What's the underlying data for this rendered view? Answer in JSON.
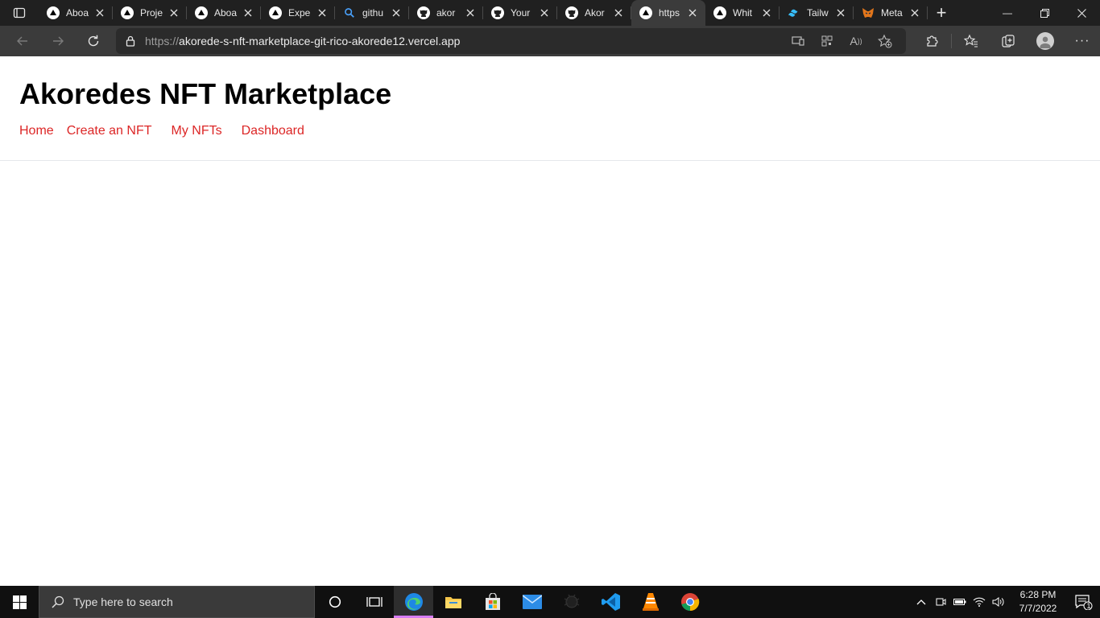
{
  "browser": {
    "tabs": [
      {
        "title": "Aboa",
        "favicon": "vercel-icon"
      },
      {
        "title": "Proje",
        "favicon": "vercel-icon"
      },
      {
        "title": "Aboa",
        "favicon": "vercel-icon"
      },
      {
        "title": "Expe",
        "favicon": "vercel-icon"
      },
      {
        "title": "githu",
        "favicon": "search-icon"
      },
      {
        "title": "akor",
        "favicon": "github-icon"
      },
      {
        "title": "Your",
        "favicon": "github-icon"
      },
      {
        "title": "Akor",
        "favicon": "github-icon"
      },
      {
        "title": "https",
        "favicon": "vercel-icon",
        "active": true
      },
      {
        "title": "Whit",
        "favicon": "vercel-icon"
      },
      {
        "title": "Tailw",
        "favicon": "tailwind-icon"
      },
      {
        "title": "Meta",
        "favicon": "metamask-icon"
      }
    ],
    "url_scheme": "https://",
    "url_host": "akorede-s-nft-marketplace-git-rico-akorede12.vercel.app"
  },
  "site": {
    "title": "Akoredes NFT Marketplace",
    "nav": {
      "home": "Home",
      "create": "Create an NFT",
      "my_nfts": "My NFTs",
      "dashboard": "Dashboard"
    },
    "nav_color": "#dc2626"
  },
  "taskbar": {
    "search_placeholder": "Type here to search",
    "time": "6:28 PM",
    "date": "7/7/2022",
    "notification_count": "1"
  }
}
